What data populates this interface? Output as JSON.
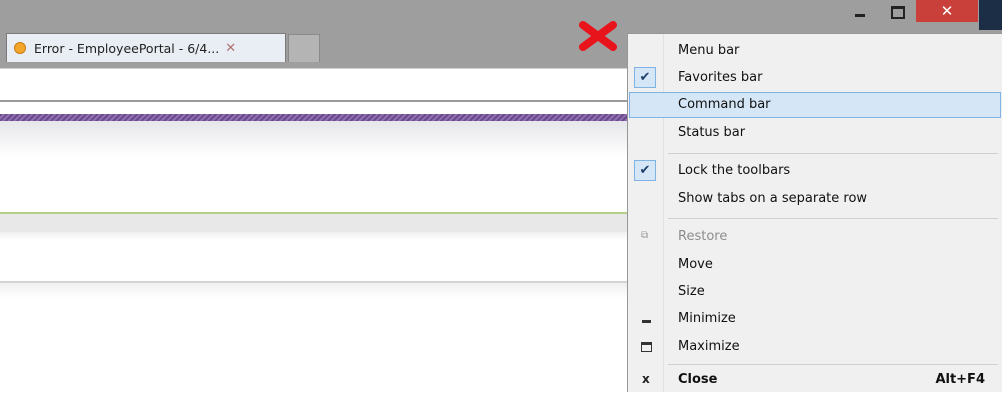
{
  "browser": {
    "tab": {
      "title": "Error - EmployeePortal - 6/4...",
      "close_glyph": "✕"
    },
    "window_controls": {
      "close_glyph": "✕"
    }
  },
  "context_menu": {
    "items": [
      {
        "label": "Menu bar",
        "checked": false
      },
      {
        "label": "Favorites bar",
        "checked": true
      },
      {
        "label": "Command bar",
        "checked": false,
        "highlighted": true
      },
      {
        "label": "Status bar",
        "checked": false
      },
      {
        "label": "Lock the toolbars",
        "checked": true
      },
      {
        "label": "Show tabs on a separate row",
        "checked": false
      },
      {
        "label": "Restore",
        "disabled": true,
        "icon": "restore-icon"
      },
      {
        "label": "Move"
      },
      {
        "label": "Size"
      },
      {
        "label": "Minimize",
        "icon": "minimize-icon"
      },
      {
        "label": "Maximize",
        "icon": "maximize-icon"
      },
      {
        "label": "Close",
        "icon": "close-icon",
        "shortcut": "Alt+F4"
      }
    ],
    "check_glyph": "✔"
  },
  "colors": {
    "highlight": "#d5e6f7",
    "highlight_border": "#7eb3e3",
    "close_button": "#c9403a",
    "annotation_x": "#e8141c"
  }
}
